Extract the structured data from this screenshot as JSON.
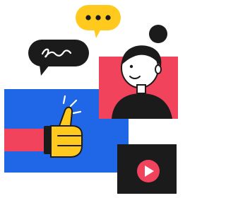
{
  "illustration": {
    "palette": {
      "blue": "#1f67e6",
      "red": "#f2435d",
      "yellow": "#ffc91e",
      "black": "#1b1b1b",
      "white": "#ffffff"
    },
    "elements": {
      "chat_bubble_dots": {
        "icon": "ellipsis-chat-bubble-icon",
        "color": "#ffc91e"
      },
      "chat_bubble_squiggle": {
        "icon": "squiggle-chat-bubble-icon",
        "color": "#1b1b1b"
      },
      "thumbs_up_panel": {
        "icon": "thumbs-up-icon",
        "background": "#1f67e6"
      },
      "person_panel": {
        "icon": "woman-avatar-icon",
        "background": "#f2435d"
      },
      "video_panel": {
        "icon": "play-button-icon",
        "background": "#1b1b1b",
        "button": "#f2435d"
      }
    }
  }
}
